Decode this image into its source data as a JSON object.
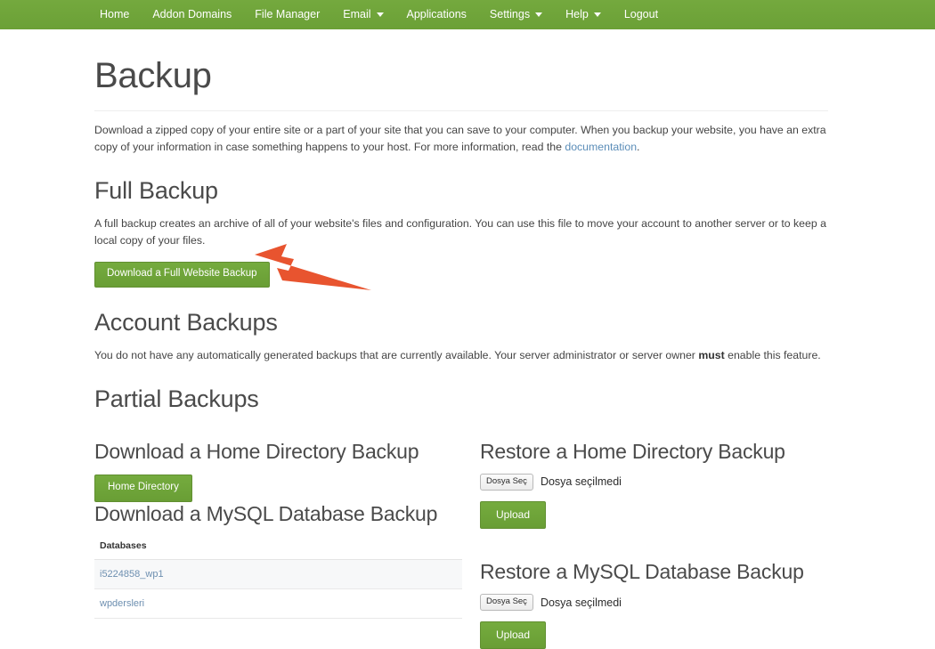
{
  "nav": {
    "items": [
      {
        "label": "Home",
        "caret": false
      },
      {
        "label": "Addon Domains",
        "caret": false
      },
      {
        "label": "File Manager",
        "caret": false
      },
      {
        "label": "Email",
        "caret": true
      },
      {
        "label": "Applications",
        "caret": false
      },
      {
        "label": "Settings",
        "caret": true
      },
      {
        "label": "Help",
        "caret": true
      },
      {
        "label": "Logout",
        "caret": false
      }
    ]
  },
  "page": {
    "title": "Backup",
    "intro_part1": "Download a zipped copy of your entire site or a part of your site that you can save to your computer. When you backup your website, you have an extra copy of your information in case something happens to your host. For more information, read the ",
    "intro_link": "documentation",
    "intro_part2": "."
  },
  "full_backup": {
    "heading": "Full Backup",
    "description": "A full backup creates an archive of all of your website's files and configuration. You can use this file to move your account to another server or to keep a local copy of your files.",
    "button_label": "Download a Full Website Backup"
  },
  "account_backups": {
    "heading": "Account Backups",
    "description_part1": "You do not have any automatically generated backups that are currently available. Your server administrator or server owner ",
    "description_bold": "must",
    "description_part2": " enable this feature."
  },
  "partial_backups": {
    "heading": "Partial Backups",
    "download_home": {
      "heading": "Download a Home Directory Backup",
      "button_label": "Home Directory"
    },
    "restore_home": {
      "heading": "Restore a Home Directory Backup",
      "file_button_label": "Dosya Seç",
      "file_status": "Dosya seçilmedi",
      "upload_label": "Upload"
    },
    "download_mysql": {
      "heading": "Download a MySQL Database Backup",
      "table_header": "Databases",
      "databases": [
        "i5224858_wp1",
        "wpdersleri"
      ]
    },
    "restore_mysql": {
      "heading": "Restore a MySQL Database Backup",
      "file_button_label": "Dosya Seç",
      "file_status": "Dosya seçilmedi",
      "upload_label": "Upload"
    }
  },
  "annotation": {
    "arrow_color": "#e8542f",
    "points_to": "Download a Full Website Backup"
  },
  "colors": {
    "nav_green": "#6fa539",
    "button_green": "#6fa539",
    "link_blue": "#5b8db8",
    "heading_gray": "#4a4a4a"
  }
}
